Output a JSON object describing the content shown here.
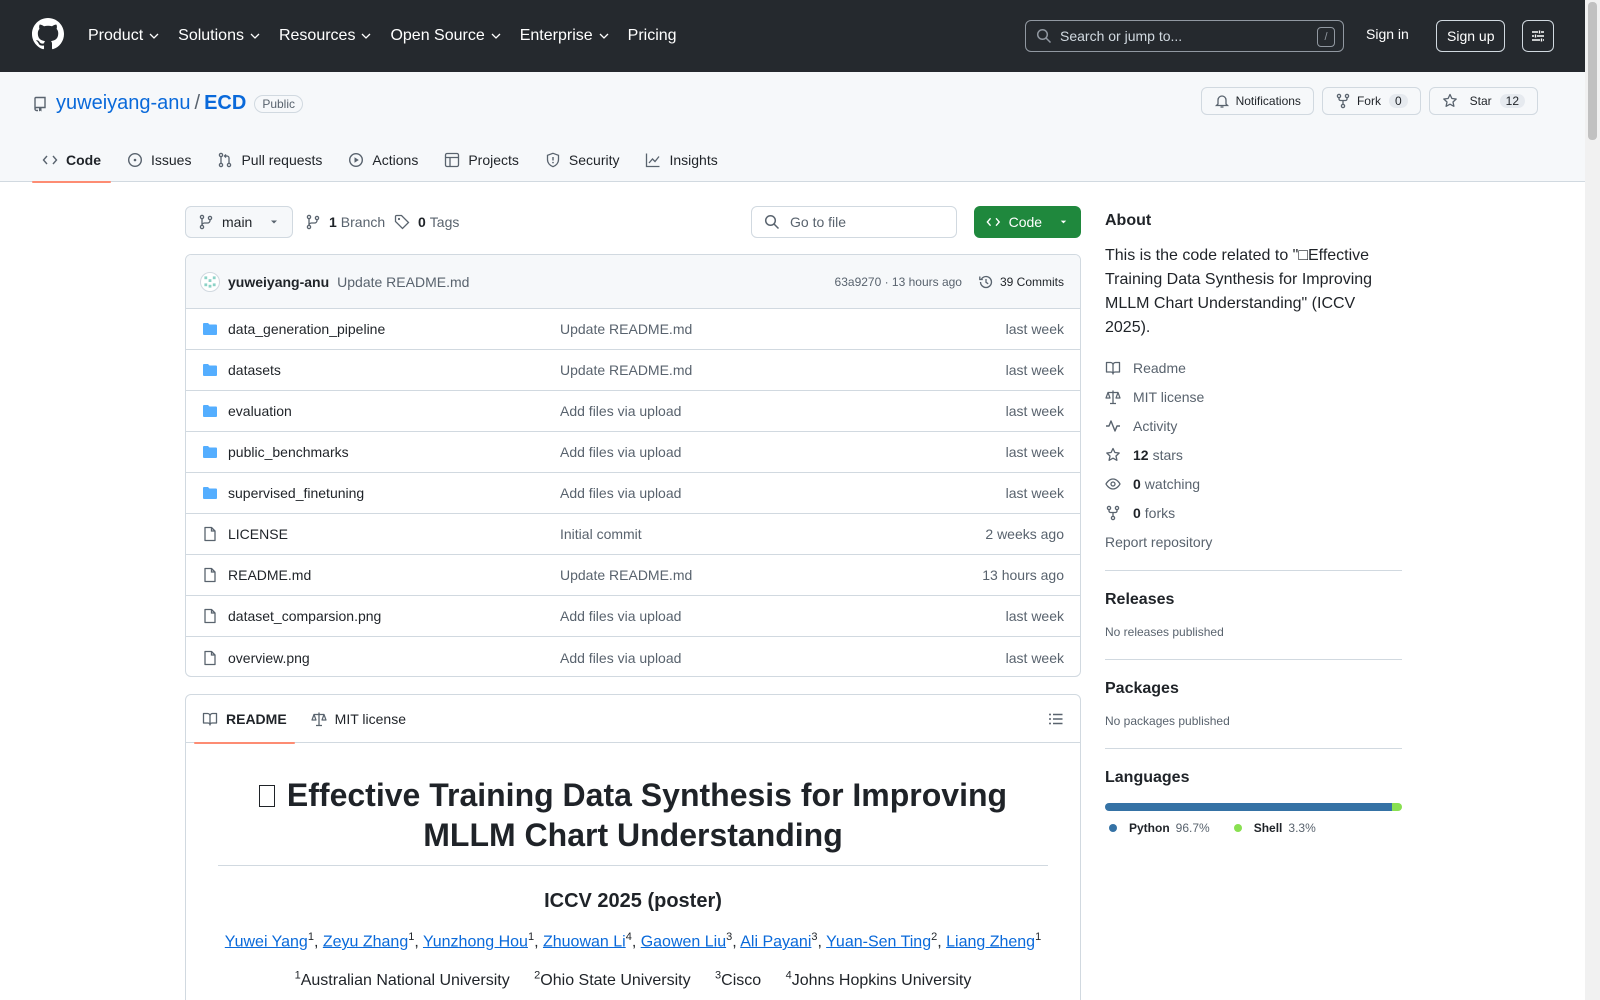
{
  "header": {
    "nav": [
      "Product",
      "Solutions",
      "Resources",
      "Open Source",
      "Enterprise",
      "Pricing"
    ],
    "search_placeholder": "Search or jump to...",
    "search_shortcut": "/",
    "signin": "Sign in",
    "signup": "Sign up"
  },
  "repo": {
    "owner": "yuweiyang-anu",
    "separator": "/",
    "name": "ECD",
    "visibility": "Public",
    "notifications_label": "Notifications",
    "fork_label": "Fork",
    "fork_count": "0",
    "star_label": "Star",
    "star_count": "12",
    "tabs": [
      "Code",
      "Issues",
      "Pull requests",
      "Actions",
      "Projects",
      "Security",
      "Insights"
    ]
  },
  "filenav": {
    "branch": "main",
    "branch_count": "1",
    "branch_label": "Branch",
    "tag_count": "0",
    "tag_label": "Tags",
    "goto_placeholder": "Go to file",
    "code_label": "Code"
  },
  "commit": {
    "author": "yuweiyang-anu",
    "message": "Update README.md",
    "hash_time": "63a9270 · 13 hours ago",
    "commits": "39 Commits"
  },
  "files": [
    {
      "type": "folder",
      "name": "data_generation_pipeline",
      "message": "Update README.md",
      "date": "last week"
    },
    {
      "type": "folder",
      "name": "datasets",
      "message": "Update README.md",
      "date": "last week"
    },
    {
      "type": "folder",
      "name": "evaluation",
      "message": "Add files via upload",
      "date": "last week"
    },
    {
      "type": "folder",
      "name": "public_benchmarks",
      "message": "Add files via upload",
      "date": "last week"
    },
    {
      "type": "folder",
      "name": "supervised_finetuning",
      "message": "Add files via upload",
      "date": "last week"
    },
    {
      "type": "file",
      "name": "LICENSE",
      "message": "Initial commit",
      "date": "2 weeks ago"
    },
    {
      "type": "file",
      "name": "README.md",
      "message": "Update README.md",
      "date": "13 hours ago"
    },
    {
      "type": "file",
      "name": "dataset_comparsion.png",
      "message": "Add files via upload",
      "date": "last week"
    },
    {
      "type": "file",
      "name": "overview.png",
      "message": "Add files via upload",
      "date": "last week"
    }
  ],
  "readme": {
    "tab_readme": "README",
    "tab_license": "MIT license",
    "title": "Effective Training Data Synthesis for Improving MLLM Chart Understanding",
    "venue": "ICCV 2025 (poster)",
    "authors": [
      {
        "name": "Yuwei Yang",
        "sup": "1"
      },
      {
        "name": "Zeyu Zhang",
        "sup": "1"
      },
      {
        "name": "Yunzhong Hou",
        "sup": "1"
      },
      {
        "name": "Zhuowan Li",
        "sup": "4"
      },
      {
        "name": "Gaowen Liu",
        "sup": "3"
      },
      {
        "name": "Ali Payani",
        "sup": "3"
      },
      {
        "name": "Yuan-Sen Ting",
        "sup": "2"
      },
      {
        "name": "Liang Zheng",
        "sup": "1"
      }
    ],
    "affiliations": [
      {
        "sup": "1",
        "name": "Australian National University"
      },
      {
        "sup": "2",
        "name": "Ohio State University"
      },
      {
        "sup": "3",
        "name": "Cisco"
      },
      {
        "sup": "4",
        "name": "Johns Hopkins University"
      }
    ]
  },
  "sidebar": {
    "about_title": "About",
    "about_text": "This is the code related to \"□Effective Training Data Synthesis for Improving MLLM Chart Understanding\" (ICCV 2025).",
    "readme": "Readme",
    "license": "MIT license",
    "activity": "Activity",
    "stars_count": "12",
    "stars_label": "stars",
    "watching_count": "0",
    "watching_label": "watching",
    "forks_count": "0",
    "forks_label": "forks",
    "report": "Report repository",
    "releases_title": "Releases",
    "releases_text": "No releases published",
    "packages_title": "Packages",
    "packages_text": "No packages published",
    "languages_title": "Languages",
    "languages": [
      {
        "name": "Python",
        "pct": "96.7%",
        "value": 96.7,
        "color": "#3572A5"
      },
      {
        "name": "Shell",
        "pct": "3.3%",
        "value": 3.3,
        "color": "#89e051"
      }
    ]
  }
}
